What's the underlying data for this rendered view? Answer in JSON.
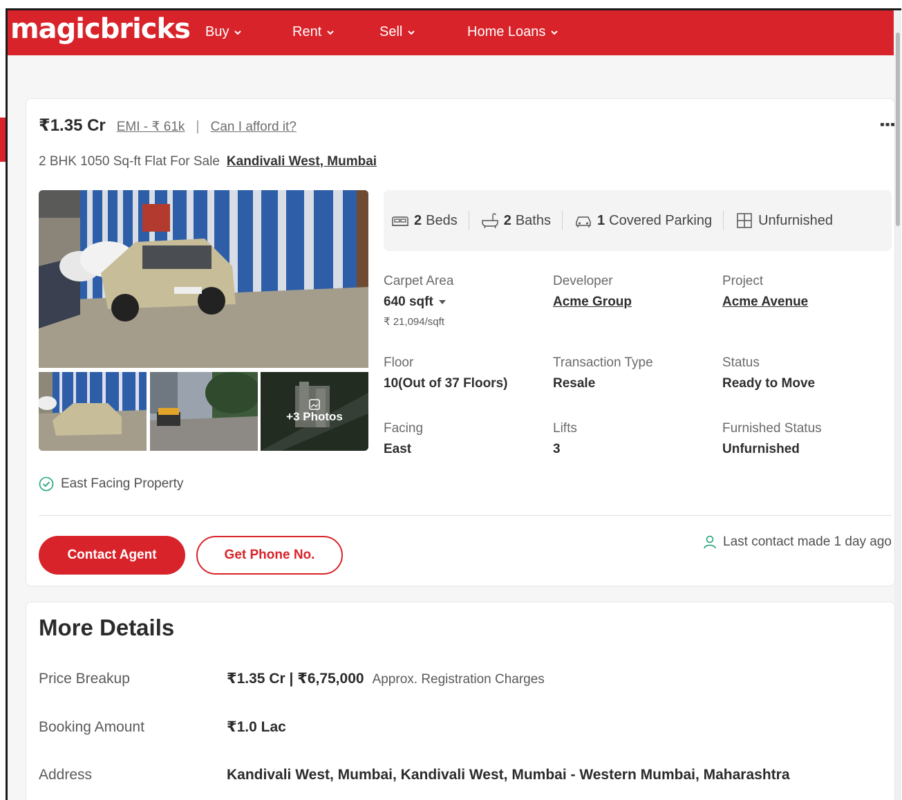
{
  "header": {
    "logo": "magicbricks",
    "nav": [
      {
        "label": "Buy"
      },
      {
        "label": "Rent"
      },
      {
        "label": "Sell"
      },
      {
        "label": "Home Loans"
      }
    ]
  },
  "listing": {
    "price": "₹1.35 Cr",
    "emi": "EMI - ₹ 61k",
    "separator": "|",
    "afford_link": "Can I afford it?",
    "title": "2 BHK 1050 Sq-ft Flat For Sale",
    "location": "Kandivali West, Mumbai",
    "photos_more": "+3 Photos",
    "specs": {
      "beds_count": "2",
      "beds_label": "Beds",
      "baths_count": "2",
      "baths_label": "Baths",
      "parking_count": "1",
      "parking_label": "Covered Parking",
      "furnishing": "Unfurnished"
    },
    "details": {
      "carpet_area_label": "Carpet Area",
      "carpet_area_value": "640 sqft",
      "price_per_sqft": "₹ 21,094/sqft",
      "developer_label": "Developer",
      "developer_value": "Acme Group",
      "project_label": "Project",
      "project_value": "Acme Avenue",
      "floor_label": "Floor",
      "floor_value": "10(Out of 37 Floors)",
      "transaction_label": "Transaction Type",
      "transaction_value": "Resale",
      "status_label": "Status",
      "status_value": "Ready to Move",
      "facing_label": "Facing",
      "facing_value": "East",
      "lifts_label": "Lifts",
      "lifts_value": "3",
      "furnished_label": "Furnished Status",
      "furnished_value": "Unfurnished"
    },
    "feature": "East Facing Property",
    "contact_button": "Contact Agent",
    "phone_button": "Get Phone No.",
    "last_contact": "Last contact made 1 day ago"
  },
  "more_details": {
    "title": "More Details",
    "price_breakup_label": "Price Breakup",
    "price_breakup_value": "₹1.35 Cr | ₹6,75,000",
    "price_breakup_note": "Approx. Registration Charges",
    "booking_label": "Booking Amount",
    "booking_value": "₹1.0 Lac",
    "address_label": "Address",
    "address_value": "Kandivali West, Mumbai, Kandivali West, Mumbai - Western Mumbai, Maharashtra"
  },
  "colors": {
    "brand_red": "#d8232a",
    "success_green": "#1fa37a"
  }
}
